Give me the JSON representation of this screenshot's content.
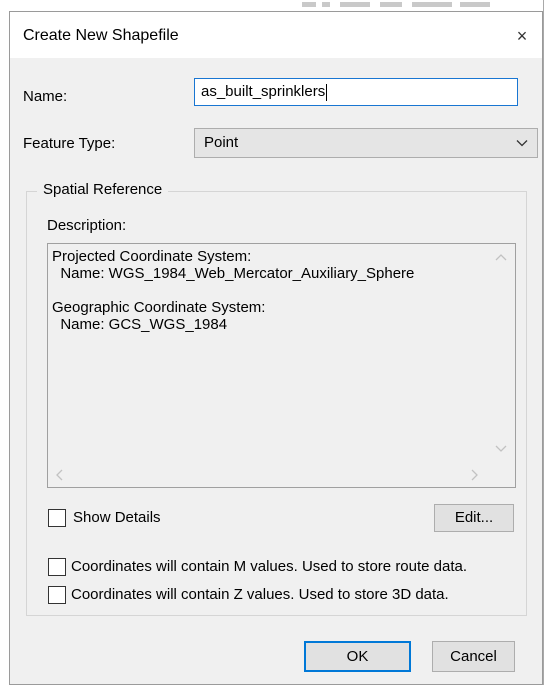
{
  "dialog": {
    "title": "Create New Shapefile",
    "close_glyph": "×",
    "name_label": "Name:",
    "name_value": "as_built_sprinklers",
    "feature_type_label": "Feature Type:",
    "feature_type_value": "Point",
    "spatial_reference": {
      "legend": "Spatial Reference",
      "description_label": "Description:",
      "description_text": "Projected Coordinate System:\n  Name: WGS_1984_Web_Mercator_Auxiliary_Sphere\n\nGeographic Coordinate System:\n  Name: GCS_WGS_1984",
      "show_details_label": "Show Details",
      "show_details_checked": false,
      "edit_button": "Edit..."
    },
    "m_values_label": "Coordinates will contain M values. Used to store route data.",
    "m_values_checked": false,
    "z_values_label": "Coordinates will contain Z values. Used to store 3D data.",
    "z_values_checked": false,
    "ok_button": "OK",
    "cancel_button": "Cancel"
  },
  "colors": {
    "dialog_bg": "#f0f0f0",
    "focus_border": "#0078d7",
    "button_bg": "#e1e1e1"
  },
  "icons": [
    "close-icon",
    "chevron-down-icon",
    "scroll-up-icon",
    "scroll-down-icon",
    "scroll-left-icon",
    "scroll-right-icon"
  ]
}
